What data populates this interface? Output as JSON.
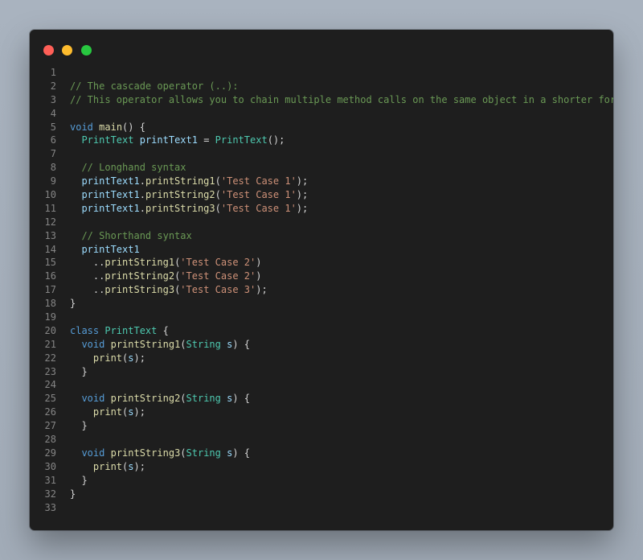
{
  "window": {
    "traffic_lights": [
      "close",
      "minimize",
      "maximize"
    ],
    "colors": {
      "close": "#ff5f57",
      "minimize": "#febc2e",
      "maximize": "#28c840",
      "background": "#1e1e1e"
    }
  },
  "editor": {
    "language": "Dart",
    "lines": [
      {
        "n": "1",
        "tokens": []
      },
      {
        "n": "2",
        "tokens": [
          {
            "t": "comment",
            "v": "// The cascade operator (..):"
          }
        ]
      },
      {
        "n": "3",
        "tokens": [
          {
            "t": "comment",
            "v": "// This operator allows you to chain multiple method calls on the same object in a shorter form."
          }
        ]
      },
      {
        "n": "4",
        "tokens": []
      },
      {
        "n": "5",
        "tokens": [
          {
            "t": "keyword",
            "v": "void"
          },
          {
            "t": "plain",
            "v": " "
          },
          {
            "t": "func",
            "v": "main"
          },
          {
            "t": "plain",
            "v": "() {"
          }
        ]
      },
      {
        "n": "6",
        "tokens": [
          {
            "t": "plain",
            "v": "  "
          },
          {
            "t": "type",
            "v": "PrintText"
          },
          {
            "t": "plain",
            "v": " "
          },
          {
            "t": "var",
            "v": "printText1"
          },
          {
            "t": "plain",
            "v": " = "
          },
          {
            "t": "type",
            "v": "PrintText"
          },
          {
            "t": "plain",
            "v": "();"
          }
        ]
      },
      {
        "n": "7",
        "tokens": []
      },
      {
        "n": "8",
        "tokens": [
          {
            "t": "plain",
            "v": "  "
          },
          {
            "t": "comment",
            "v": "// Longhand syntax"
          }
        ]
      },
      {
        "n": "9",
        "tokens": [
          {
            "t": "plain",
            "v": "  "
          },
          {
            "t": "var",
            "v": "printText1"
          },
          {
            "t": "plain",
            "v": "."
          },
          {
            "t": "func",
            "v": "printString1"
          },
          {
            "t": "plain",
            "v": "("
          },
          {
            "t": "string",
            "v": "'Test Case 1'"
          },
          {
            "t": "plain",
            "v": ");"
          }
        ]
      },
      {
        "n": "10",
        "tokens": [
          {
            "t": "plain",
            "v": "  "
          },
          {
            "t": "var",
            "v": "printText1"
          },
          {
            "t": "plain",
            "v": "."
          },
          {
            "t": "func",
            "v": "printString2"
          },
          {
            "t": "plain",
            "v": "("
          },
          {
            "t": "string",
            "v": "'Test Case 1'"
          },
          {
            "t": "plain",
            "v": ");"
          }
        ]
      },
      {
        "n": "11",
        "tokens": [
          {
            "t": "plain",
            "v": "  "
          },
          {
            "t": "var",
            "v": "printText1"
          },
          {
            "t": "plain",
            "v": "."
          },
          {
            "t": "func",
            "v": "printString3"
          },
          {
            "t": "plain",
            "v": "("
          },
          {
            "t": "string",
            "v": "'Test Case 1'"
          },
          {
            "t": "plain",
            "v": ");"
          }
        ]
      },
      {
        "n": "12",
        "tokens": []
      },
      {
        "n": "13",
        "tokens": [
          {
            "t": "plain",
            "v": "  "
          },
          {
            "t": "comment",
            "v": "// Shorthand syntax"
          }
        ]
      },
      {
        "n": "14",
        "tokens": [
          {
            "t": "plain",
            "v": "  "
          },
          {
            "t": "var",
            "v": "printText1"
          }
        ]
      },
      {
        "n": "15",
        "tokens": [
          {
            "t": "plain",
            "v": "    .."
          },
          {
            "t": "func",
            "v": "printString1"
          },
          {
            "t": "plain",
            "v": "("
          },
          {
            "t": "string",
            "v": "'Test Case 2'"
          },
          {
            "t": "plain",
            "v": ")"
          }
        ]
      },
      {
        "n": "16",
        "tokens": [
          {
            "t": "plain",
            "v": "    .."
          },
          {
            "t": "func",
            "v": "printString2"
          },
          {
            "t": "plain",
            "v": "("
          },
          {
            "t": "string",
            "v": "'Test Case 2'"
          },
          {
            "t": "plain",
            "v": ")"
          }
        ]
      },
      {
        "n": "17",
        "tokens": [
          {
            "t": "plain",
            "v": "    .."
          },
          {
            "t": "func",
            "v": "printString3"
          },
          {
            "t": "plain",
            "v": "("
          },
          {
            "t": "string",
            "v": "'Test Case 3'"
          },
          {
            "t": "plain",
            "v": ");"
          }
        ]
      },
      {
        "n": "18",
        "tokens": [
          {
            "t": "plain",
            "v": "}"
          }
        ]
      },
      {
        "n": "19",
        "tokens": []
      },
      {
        "n": "20",
        "tokens": [
          {
            "t": "keyword",
            "v": "class"
          },
          {
            "t": "plain",
            "v": " "
          },
          {
            "t": "type",
            "v": "PrintText"
          },
          {
            "t": "plain",
            "v": " {"
          }
        ]
      },
      {
        "n": "21",
        "tokens": [
          {
            "t": "plain",
            "v": "  "
          },
          {
            "t": "keyword",
            "v": "void"
          },
          {
            "t": "plain",
            "v": " "
          },
          {
            "t": "func",
            "v": "printString1"
          },
          {
            "t": "plain",
            "v": "("
          },
          {
            "t": "type",
            "v": "String"
          },
          {
            "t": "plain",
            "v": " "
          },
          {
            "t": "var",
            "v": "s"
          },
          {
            "t": "plain",
            "v": ") {"
          }
        ]
      },
      {
        "n": "22",
        "tokens": [
          {
            "t": "plain",
            "v": "    "
          },
          {
            "t": "func",
            "v": "print"
          },
          {
            "t": "plain",
            "v": "("
          },
          {
            "t": "var",
            "v": "s"
          },
          {
            "t": "plain",
            "v": ");"
          }
        ]
      },
      {
        "n": "23",
        "tokens": [
          {
            "t": "plain",
            "v": "  }"
          }
        ]
      },
      {
        "n": "24",
        "tokens": []
      },
      {
        "n": "25",
        "tokens": [
          {
            "t": "plain",
            "v": "  "
          },
          {
            "t": "keyword",
            "v": "void"
          },
          {
            "t": "plain",
            "v": " "
          },
          {
            "t": "func",
            "v": "printString2"
          },
          {
            "t": "plain",
            "v": "("
          },
          {
            "t": "type",
            "v": "String"
          },
          {
            "t": "plain",
            "v": " "
          },
          {
            "t": "var",
            "v": "s"
          },
          {
            "t": "plain",
            "v": ") {"
          }
        ]
      },
      {
        "n": "26",
        "tokens": [
          {
            "t": "plain",
            "v": "    "
          },
          {
            "t": "func",
            "v": "print"
          },
          {
            "t": "plain",
            "v": "("
          },
          {
            "t": "var",
            "v": "s"
          },
          {
            "t": "plain",
            "v": ");"
          }
        ]
      },
      {
        "n": "27",
        "tokens": [
          {
            "t": "plain",
            "v": "  }"
          }
        ]
      },
      {
        "n": "28",
        "tokens": []
      },
      {
        "n": "29",
        "tokens": [
          {
            "t": "plain",
            "v": "  "
          },
          {
            "t": "keyword",
            "v": "void"
          },
          {
            "t": "plain",
            "v": " "
          },
          {
            "t": "func",
            "v": "printString3"
          },
          {
            "t": "plain",
            "v": "("
          },
          {
            "t": "type",
            "v": "String"
          },
          {
            "t": "plain",
            "v": " "
          },
          {
            "t": "var",
            "v": "s"
          },
          {
            "t": "plain",
            "v": ") {"
          }
        ]
      },
      {
        "n": "30",
        "tokens": [
          {
            "t": "plain",
            "v": "    "
          },
          {
            "t": "func",
            "v": "print"
          },
          {
            "t": "plain",
            "v": "("
          },
          {
            "t": "var",
            "v": "s"
          },
          {
            "t": "plain",
            "v": ");"
          }
        ]
      },
      {
        "n": "31",
        "tokens": [
          {
            "t": "plain",
            "v": "  }"
          }
        ]
      },
      {
        "n": "32",
        "tokens": [
          {
            "t": "plain",
            "v": "}"
          }
        ]
      },
      {
        "n": "33",
        "tokens": []
      }
    ]
  }
}
